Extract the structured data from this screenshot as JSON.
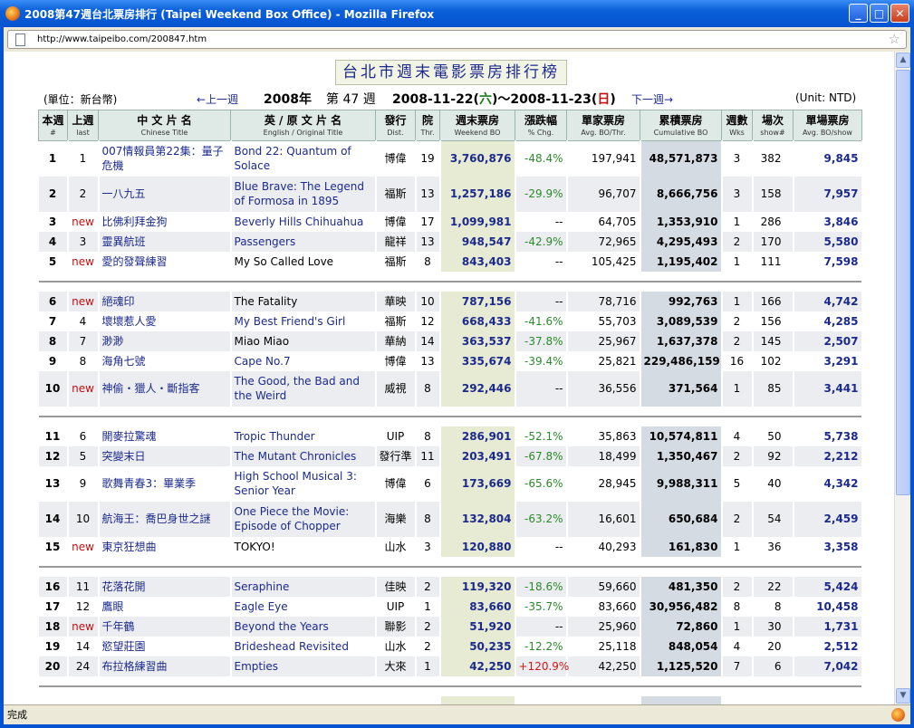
{
  "window": {
    "title": "2008第47週台北票房排行 (Taipei Weekend Box Office) - Mozilla Firefox",
    "url": "http://www.taipeibo.com/200847.htm",
    "status": "完成"
  },
  "page": {
    "heading": "台北市週末電影票房排行榜",
    "unit_cn": "(單位：新台幣)",
    "prev_week": "←上一週",
    "year": "2008年",
    "week": "第 47 週",
    "date_start": "2008-11-22(",
    "sat": "六",
    "range_mid": ")～2008-11-23(",
    "sun": "日",
    "range_end": ")",
    "next_week": "下一週→",
    "unit_en": "(Unit: NTD)"
  },
  "columns": [
    {
      "cn": "本週",
      "en": "#"
    },
    {
      "cn": "上週",
      "en": "last"
    },
    {
      "cn": "中 文 片 名",
      "en": "Chinese Title"
    },
    {
      "cn": "英 / 原 文 片 名",
      "en": "English / Original Title"
    },
    {
      "cn": "發行",
      "en": "Dist."
    },
    {
      "cn": "院",
      "en": "Thr."
    },
    {
      "cn": "週末票房",
      "en": "Weekend BO"
    },
    {
      "cn": "漲跌幅",
      "en": "% Chg."
    },
    {
      "cn": "單家票房",
      "en": "Avg. BO/Thr."
    },
    {
      "cn": "累積票房",
      "en": "Cumulative BO"
    },
    {
      "cn": "週數",
      "en": "Wks"
    },
    {
      "cn": "場次",
      "en": "show#"
    },
    {
      "cn": "單場票房",
      "en": "Avg. BO/show"
    }
  ],
  "rows": [
    {
      "rank": "1",
      "last": "1",
      "cn": "007情報員第22集：量子危機",
      "en": "Bond 22: Quantum of Solace",
      "link": true,
      "dist": "博偉",
      "thr": "19",
      "weekend": "3,760,876",
      "chg": "-48.4%",
      "avg": "197,941",
      "cum": "48,571,873",
      "wks": "3",
      "shows": "382",
      "avgshow": "9,845"
    },
    {
      "rank": "2",
      "last": "2",
      "cn": "一八九五",
      "en": "Blue Brave: The Legend of Formosa in 1895",
      "link": true,
      "dist": "福斯",
      "thr": "13",
      "weekend": "1,257,186",
      "chg": "-29.9%",
      "avg": "96,707",
      "cum": "8,666,756",
      "wks": "3",
      "shows": "158",
      "avgshow": "7,957"
    },
    {
      "rank": "3",
      "last": "new",
      "cn": "比佛利拜金狗",
      "en": "Beverly Hills Chihuahua",
      "link": true,
      "dist": "博偉",
      "thr": "17",
      "weekend": "1,099,981",
      "chg": "--",
      "avg": "64,705",
      "cum": "1,353,910",
      "wks": "1",
      "shows": "286",
      "avgshow": "3,846"
    },
    {
      "rank": "4",
      "last": "3",
      "cn": "靈異航班",
      "en": "Passengers",
      "link": true,
      "dist": "龍祥",
      "thr": "13",
      "weekend": "948,547",
      "chg": "-42.9%",
      "avg": "72,965",
      "cum": "4,295,493",
      "wks": "2",
      "shows": "170",
      "avgshow": "5,580"
    },
    {
      "rank": "5",
      "last": "new",
      "cn": "愛的發聲練習",
      "en": "My So Called Love",
      "link": false,
      "dist": "福斯",
      "thr": "8",
      "weekend": "843,403",
      "chg": "--",
      "avg": "105,425",
      "cum": "1,195,402",
      "wks": "1",
      "shows": "111",
      "avgshow": "7,598"
    },
    {
      "rank": "6",
      "last": "new",
      "cn": "絕魂印",
      "en": "The Fatality",
      "link": false,
      "dist": "華映",
      "thr": "10",
      "weekend": "787,156",
      "chg": "--",
      "avg": "78,716",
      "cum": "992,763",
      "wks": "1",
      "shows": "166",
      "avgshow": "4,742"
    },
    {
      "rank": "7",
      "last": "4",
      "cn": "壞壞惹人愛",
      "en": "My Best Friend's Girl",
      "link": true,
      "dist": "福斯",
      "thr": "12",
      "weekend": "668,433",
      "chg": "-41.6%",
      "avg": "55,703",
      "cum": "3,089,539",
      "wks": "2",
      "shows": "156",
      "avgshow": "4,285"
    },
    {
      "rank": "8",
      "last": "7",
      "cn": "渺渺",
      "en": "Miao Miao",
      "link": false,
      "dist": "華納",
      "thr": "14",
      "weekend": "363,537",
      "chg": "-37.8%",
      "avg": "25,967",
      "cum": "1,637,378",
      "wks": "2",
      "shows": "145",
      "avgshow": "2,507"
    },
    {
      "rank": "9",
      "last": "8",
      "cn": "海角七號",
      "en": "Cape No.7",
      "link": true,
      "dist": "博偉",
      "thr": "13",
      "weekend": "335,674",
      "chg": "-39.4%",
      "avg": "25,821",
      "cum": "229,486,159",
      "wks": "16",
      "shows": "102",
      "avgshow": "3,291"
    },
    {
      "rank": "10",
      "last": "new",
      "cn": "神偷・獵人・斷指客",
      "en": "The Good, the Bad and the Weird",
      "link": true,
      "dist": "威視",
      "thr": "8",
      "weekend": "292,446",
      "chg": "--",
      "avg": "36,556",
      "cum": "371,564",
      "wks": "1",
      "shows": "85",
      "avgshow": "3,441"
    },
    {
      "rank": "11",
      "last": "6",
      "cn": "開麥拉驚魂",
      "en": "Tropic Thunder",
      "link": true,
      "dist": "UIP",
      "thr": "8",
      "weekend": "286,901",
      "chg": "-52.1%",
      "avg": "35,863",
      "cum": "10,574,811",
      "wks": "4",
      "shows": "50",
      "avgshow": "5,738"
    },
    {
      "rank": "12",
      "last": "5",
      "cn": "突變末日",
      "en": "The Mutant Chronicles",
      "link": true,
      "dist": "發行準",
      "thr": "11",
      "weekend": "203,491",
      "chg": "-67.8%",
      "avg": "18,499",
      "cum": "1,350,467",
      "wks": "2",
      "shows": "92",
      "avgshow": "2,212"
    },
    {
      "rank": "13",
      "last": "9",
      "cn": "歌舞青春3：畢業季",
      "en": "High School Musical 3: Senior Year",
      "link": true,
      "dist": "博偉",
      "thr": "6",
      "weekend": "173,669",
      "chg": "-65.6%",
      "avg": "28,945",
      "cum": "9,988,311",
      "wks": "5",
      "shows": "40",
      "avgshow": "4,342"
    },
    {
      "rank": "14",
      "last": "10",
      "cn": "航海王：喬巴身世之謎",
      "en": "One Piece the Movie: Episode of Chopper",
      "link": true,
      "dist": "海樂",
      "thr": "8",
      "weekend": "132,804",
      "chg": "-63.2%",
      "avg": "16,601",
      "cum": "650,684",
      "wks": "2",
      "shows": "54",
      "avgshow": "2,459"
    },
    {
      "rank": "15",
      "last": "new",
      "cn": "東京狂想曲",
      "en": "TOKYO!",
      "link": false,
      "dist": "山水",
      "thr": "3",
      "weekend": "120,880",
      "chg": "--",
      "avg": "40,293",
      "cum": "161,830",
      "wks": "1",
      "shows": "36",
      "avgshow": "3,358"
    },
    {
      "rank": "16",
      "last": "11",
      "cn": "花落花開",
      "en": "Seraphine",
      "link": true,
      "dist": "佳映",
      "thr": "2",
      "weekend": "119,320",
      "chg": "-18.6%",
      "avg": "59,660",
      "cum": "481,350",
      "wks": "2",
      "shows": "22",
      "avgshow": "5,424"
    },
    {
      "rank": "17",
      "last": "12",
      "cn": "鷹眼",
      "en": "Eagle Eye",
      "link": true,
      "dist": "UIP",
      "thr": "1",
      "weekend": "83,660",
      "chg": "-35.7%",
      "avg": "83,660",
      "cum": "30,956,482",
      "wks": "8",
      "shows": "8",
      "avgshow": "10,458"
    },
    {
      "rank": "18",
      "last": "new",
      "cn": "千年鶴",
      "en": "Beyond the Years",
      "link": true,
      "dist": "聯影",
      "thr": "2",
      "weekend": "51,920",
      "chg": "--",
      "avg": "25,960",
      "cum": "72,860",
      "wks": "1",
      "shows": "30",
      "avgshow": "1,731"
    },
    {
      "rank": "19",
      "last": "14",
      "cn": "慾望莊園",
      "en": "Brideshead Revisited",
      "link": true,
      "dist": "山水",
      "thr": "2",
      "weekend": "50,235",
      "chg": "-12.2%",
      "avg": "25,118",
      "cum": "848,054",
      "wks": "4",
      "shows": "20",
      "avgshow": "2,512"
    },
    {
      "rank": "20",
      "last": "24",
      "cn": "布拉格練習曲",
      "en": "Empties",
      "link": true,
      "dist": "大來",
      "thr": "1",
      "weekend": "42,250",
      "chg": "+120.9%",
      "avg": "42,250",
      "cum": "1,125,520",
      "wks": "7",
      "shows": "6",
      "avgshow": "7,042"
    }
  ]
}
